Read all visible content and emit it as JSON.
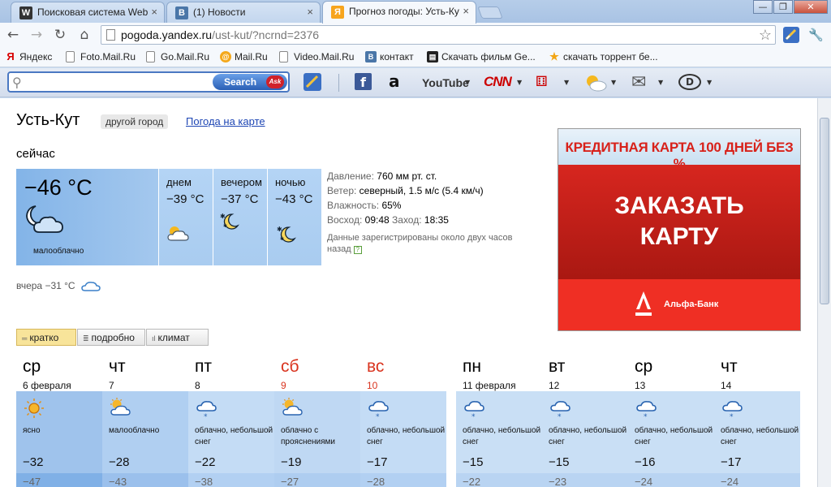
{
  "browser": {
    "tabs": [
      {
        "label": "Поисковая система Web",
        "favicon": "W",
        "favicon_color": "#333333"
      },
      {
        "label": "(1) Новости",
        "favicon": "B",
        "favicon_color": "#4a76a8"
      },
      {
        "label": "Прогноз погоды: Усть-Ку",
        "favicon": "Я",
        "favicon_color": "#f7a51d"
      }
    ],
    "url_host": "pogoda.yandex.ru",
    "url_path": "/ust-kut/?ncrnd=2376",
    "bookmarks": [
      {
        "label": "Яндекс",
        "icon": "yandex-icon"
      },
      {
        "label": "Foto.Mail.Ru",
        "icon": "page-icon"
      },
      {
        "label": "Go.Mail.Ru",
        "icon": "page-icon"
      },
      {
        "label": "Mail.Ru",
        "icon": "mailru-icon"
      },
      {
        "label": "Video.Mail.Ru",
        "icon": "page-icon"
      },
      {
        "label": "контакт",
        "icon": "vk-icon"
      },
      {
        "label": "Скачать фильм Ge...",
        "icon": "film-icon"
      },
      {
        "label": "скачать торрент бе...",
        "icon": "star-icon"
      }
    ],
    "ask_search_label": "Search",
    "ask_badge": "Ask",
    "toolbar_sites": {
      "youtube": "YouTube",
      "cnn": "CNN"
    }
  },
  "weather": {
    "city": "Усть-Кут",
    "other_city": "другой город",
    "map_link": "Погода на карте",
    "now_label": "сейчас",
    "now_temp": "−46 °C",
    "now_condition": "малооблачно",
    "parts": [
      {
        "name": "днем",
        "temp": "−39 °C"
      },
      {
        "name": "вечером",
        "temp": "−37 °C"
      },
      {
        "name": "ночью",
        "temp": "−43 °C"
      }
    ],
    "details": {
      "pressure_label": "Давление:",
      "pressure": "760 мм рт. ст.",
      "wind_label": "Ветер:",
      "wind": "северный, 1.5 м/с (5.4 км/ч)",
      "humidity_label": "Влажность:",
      "humidity": "65%",
      "sunrise_label": "Восход:",
      "sunrise": "09:48",
      "sunset_label": "Заход:",
      "sunset": "18:35",
      "note": "Данные зарегистрированы около двух часов назад"
    },
    "yesterday": "вчера −31 °C",
    "view_tabs": [
      "кратко",
      "подробно",
      "климат"
    ],
    "forecast": [
      {
        "dow": "ср",
        "date": "6 февраля",
        "weekend": false,
        "icon": "sun-icon",
        "condition": "ясно",
        "day": "−32",
        "night": "−47"
      },
      {
        "dow": "чт",
        "date": "7",
        "weekend": false,
        "icon": "sun-cloud-icon",
        "condition": "малооблачно",
        "day": "−28",
        "night": "−43"
      },
      {
        "dow": "пт",
        "date": "8",
        "weekend": false,
        "icon": "snow-cloud-icon",
        "condition": "облачно, небольшой снег",
        "day": "−22",
        "night": "−38"
      },
      {
        "dow": "сб",
        "date": "9",
        "weekend": true,
        "icon": "sun-cloud-icon",
        "condition": "облачно с прояснениями",
        "day": "−19",
        "night": "−27"
      },
      {
        "dow": "вс",
        "date": "10",
        "weekend": true,
        "icon": "snow-cloud-icon",
        "condition": "облачно, небольшой снег",
        "day": "−17",
        "night": "−28"
      },
      {
        "dow": "пн",
        "date": "11 февраля",
        "weekend": false,
        "icon": "snow-cloud-icon",
        "condition": "облачно, небольшой снег",
        "day": "−15",
        "night": "−22"
      },
      {
        "dow": "вт",
        "date": "12",
        "weekend": false,
        "icon": "snow-cloud-icon",
        "condition": "облачно, небольшой снег",
        "day": "−15",
        "night": "−23"
      },
      {
        "dow": "ср",
        "date": "13",
        "weekend": false,
        "icon": "snow-cloud-icon",
        "condition": "облачно, небольшой снег",
        "day": "−16",
        "night": "−24"
      },
      {
        "dow": "чт",
        "date": "14",
        "weekend": false,
        "icon": "snow-cloud-icon",
        "condition": "облачно, небольшой снег",
        "day": "−17",
        "night": "−24"
      }
    ]
  },
  "ad": {
    "headline": "КРЕДИТНАЯ КАРТА 100 ДНЕЙ БЕЗ %",
    "cta_line1": "ЗАКАЗАТЬ",
    "cta_line2": "КАРТУ",
    "bank": "Альфа-Банк",
    "colors": {
      "red": "#ef2f24",
      "dark_red": "#a91812"
    }
  },
  "colors": {
    "accent_link": "#1e46b4",
    "weekend": "#d9341f",
    "card_blue": "#83b4e8"
  }
}
